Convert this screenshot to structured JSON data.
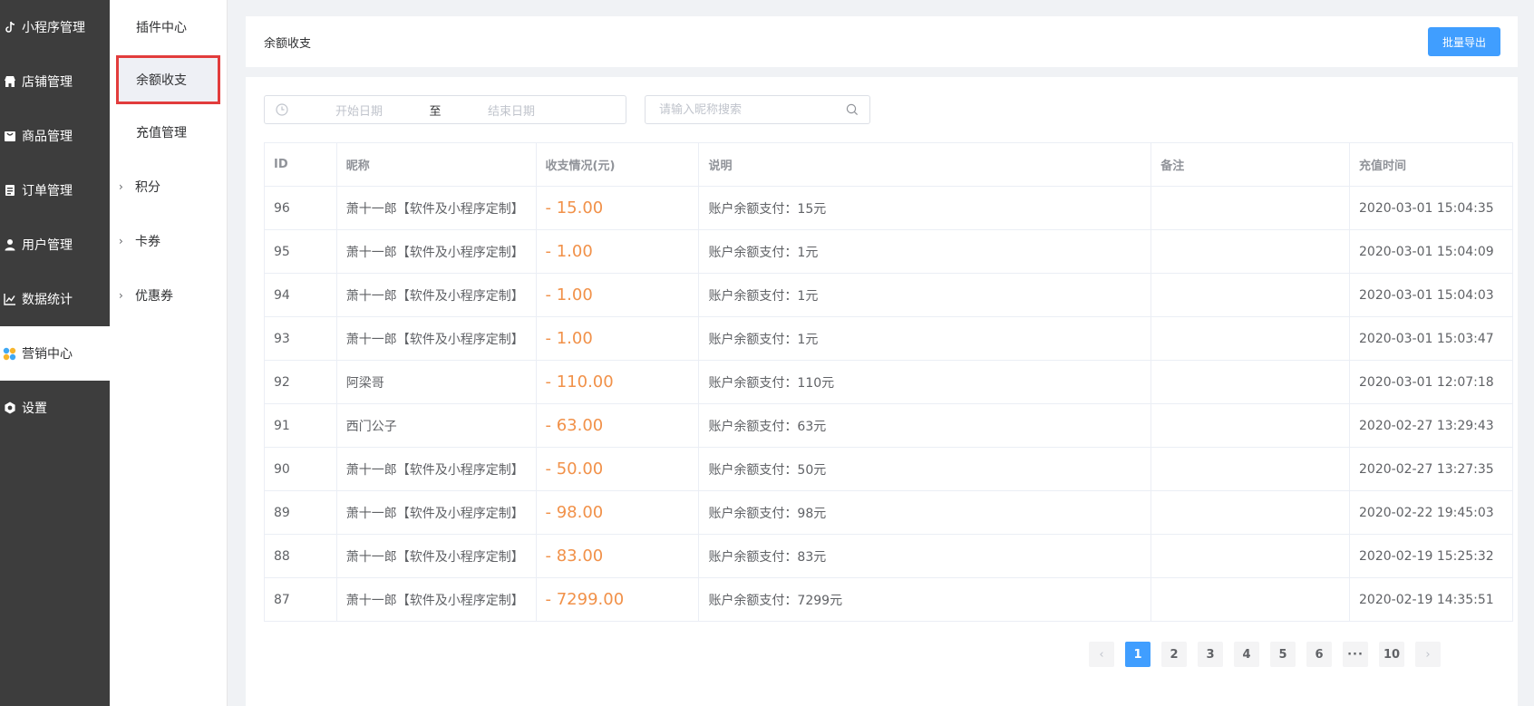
{
  "sidebar": {
    "items": [
      {
        "label": "小程序管理",
        "icon": "tiktok-note-icon"
      },
      {
        "label": "店铺管理",
        "icon": "store-icon"
      },
      {
        "label": "商品管理",
        "icon": "goods-icon"
      },
      {
        "label": "订单管理",
        "icon": "order-icon"
      },
      {
        "label": "用户管理",
        "icon": "user-icon"
      },
      {
        "label": "数据统计",
        "icon": "chart-icon"
      },
      {
        "label": "营销中心",
        "icon": "marketing-icon"
      },
      {
        "label": "设置",
        "icon": "settings-icon"
      }
    ],
    "active_index": 6
  },
  "submenu": {
    "items": [
      {
        "label": "插件中心"
      },
      {
        "label": "余额收支"
      },
      {
        "label": "充值管理"
      },
      {
        "label": "积分"
      },
      {
        "label": "卡券"
      },
      {
        "label": "优惠券"
      }
    ],
    "current_index": 1,
    "highlight_color": "#e23c3c"
  },
  "header": {
    "title": "余额收支",
    "export_label": "批量导出"
  },
  "filters": {
    "start_placeholder": "开始日期",
    "separator": "至",
    "end_placeholder": "结束日期",
    "search_placeholder": "请输入昵称搜索"
  },
  "table": {
    "columns": [
      "ID",
      "昵称",
      "收支情况(元)",
      "说明",
      "备注",
      "充值时间"
    ],
    "rows": [
      [
        "96",
        "萧十一郎【软件及小程序定制】",
        "- 15.00",
        "账户余额支付：15元",
        "",
        "2020-03-01 15:04:35"
      ],
      [
        "95",
        "萧十一郎【软件及小程序定制】",
        "- 1.00",
        "账户余额支付：1元",
        "",
        "2020-03-01 15:04:09"
      ],
      [
        "94",
        "萧十一郎【软件及小程序定制】",
        "- 1.00",
        "账户余额支付：1元",
        "",
        "2020-03-01 15:04:03"
      ],
      [
        "93",
        "萧十一郎【软件及小程序定制】",
        "- 1.00",
        "账户余额支付：1元",
        "",
        "2020-03-01 15:03:47"
      ],
      [
        "92",
        "阿梁哥",
        "- 110.00",
        "账户余额支付：110元",
        "",
        "2020-03-01 12:07:18"
      ],
      [
        "91",
        "西门公子",
        "- 63.00",
        "账户余额支付：63元",
        "",
        "2020-02-27 13:29:43"
      ],
      [
        "90",
        "萧十一郎【软件及小程序定制】",
        "- 50.00",
        "账户余额支付：50元",
        "",
        "2020-02-27 13:27:35"
      ],
      [
        "89",
        "萧十一郎【软件及小程序定制】",
        "- 98.00",
        "账户余额支付：98元",
        "",
        "2020-02-22 19:45:03"
      ],
      [
        "88",
        "萧十一郎【软件及小程序定制】",
        "- 83.00",
        "账户余额支付：83元",
        "",
        "2020-02-19 15:25:32"
      ],
      [
        "87",
        "萧十一郎【软件及小程序定制】",
        "- 7299.00",
        "账户余额支付：7299元",
        "",
        "2020-02-19 14:35:51"
      ]
    ]
  },
  "pagination": {
    "prev": "‹",
    "pages": [
      "1",
      "2",
      "3",
      "4",
      "5",
      "6"
    ],
    "ellipsis": "···",
    "last": "10",
    "next": "›",
    "current": "1"
  },
  "colors": {
    "primary": "#409eff",
    "amount": "#f19149",
    "sidebar_bg": "#3d3d3d"
  }
}
